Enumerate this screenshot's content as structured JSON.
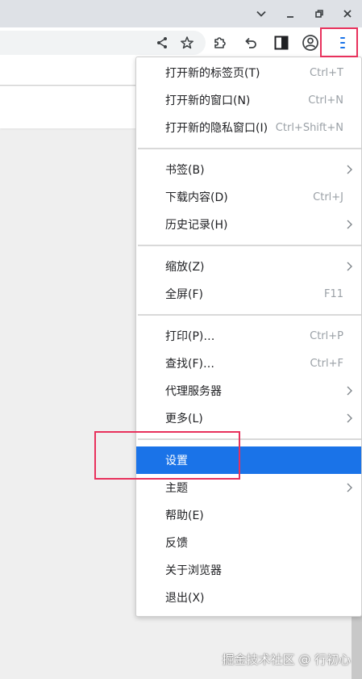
{
  "colors": {
    "selected_bg": "#1a73e8",
    "annotation_box": "#e8315c",
    "menu_icon_accent": "#1a73e8"
  },
  "window_controls": {
    "items": [
      {
        "icon": "chevron-down-icon"
      },
      {
        "icon": "minimize-icon"
      },
      {
        "icon": "restore-icon"
      },
      {
        "icon": "close-icon"
      }
    ]
  },
  "toolbar": {
    "icons": [
      "share-icon",
      "star-icon",
      "extensions-puzzle-icon",
      "undo-icon",
      "side-panel-icon",
      "profile-icon",
      "menu-kebab-icon"
    ]
  },
  "menu": {
    "groups": [
      [
        {
          "label": "打开新的标签页(T)",
          "shortcut": "Ctrl+T"
        },
        {
          "label": "打开新的窗口(N)",
          "shortcut": "Ctrl+N"
        },
        {
          "label": "打开新的隐私窗口(I)",
          "shortcut": "Ctrl+Shift+N"
        }
      ],
      [
        {
          "label": "书签(B)",
          "submenu": true
        },
        {
          "label": "下载内容(D)",
          "shortcut": "Ctrl+J"
        },
        {
          "label": "历史记录(H)",
          "submenu": true
        }
      ],
      [
        {
          "label": "缩放(Z)",
          "submenu": true
        },
        {
          "label": "全屏(F)",
          "shortcut": "F11"
        }
      ],
      [
        {
          "label": "打印(P)…",
          "shortcut": "Ctrl+P"
        },
        {
          "label": "查找(F)…",
          "shortcut": "Ctrl+F"
        },
        {
          "label": "代理服务器",
          "submenu": true
        },
        {
          "label": "更多(L)",
          "submenu": true
        }
      ],
      [
        {
          "label": "设置",
          "selected": true
        },
        {
          "label": "主题",
          "submenu": true
        },
        {
          "label": "帮助(E)"
        },
        {
          "label": "反馈"
        },
        {
          "label": "关于浏览器"
        },
        {
          "label": "退出(X)"
        }
      ]
    ]
  },
  "watermark": {
    "text": "掘金技术社区 @ 行初心"
  }
}
